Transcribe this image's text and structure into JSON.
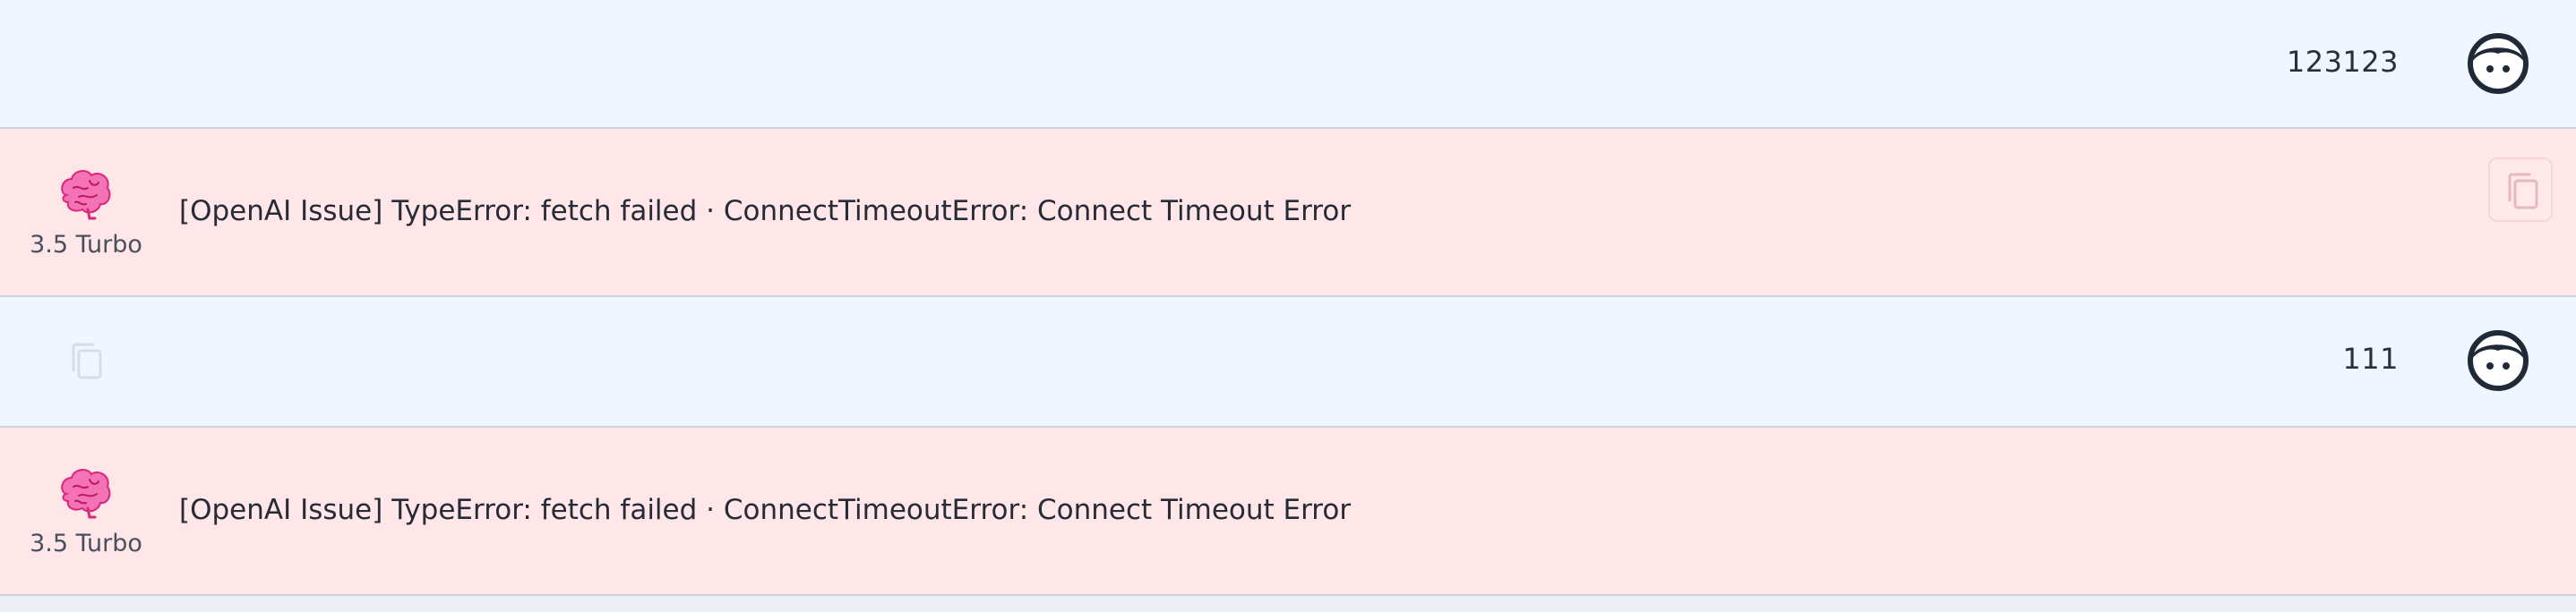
{
  "messages": [
    {
      "role": "user",
      "text": "123123",
      "avatar_icon": "user-face-icon"
    },
    {
      "role": "assistant",
      "model_label": "3.5 Turbo",
      "model_icon": "brain-icon",
      "text": "[OpenAI Issue] TypeError: fetch failed · ConnectTimeoutError: Connect Timeout Error",
      "copy_icon": "copy-icon"
    },
    {
      "role": "user",
      "text": "111",
      "avatar_icon": "user-face-icon",
      "copy_icon": "copy-icon"
    },
    {
      "role": "assistant",
      "model_label": "3.5 Turbo",
      "model_icon": "brain-icon",
      "text": "[OpenAI Issue] TypeError: fetch failed · ConnectTimeoutError: Connect Timeout Error"
    }
  ],
  "colors": {
    "user_row_bg": "#eff6ff",
    "assistant_row_bg": "#ffe6e8",
    "brain_pink": "#f472b6",
    "avatar_dark": "#1f2937"
  }
}
